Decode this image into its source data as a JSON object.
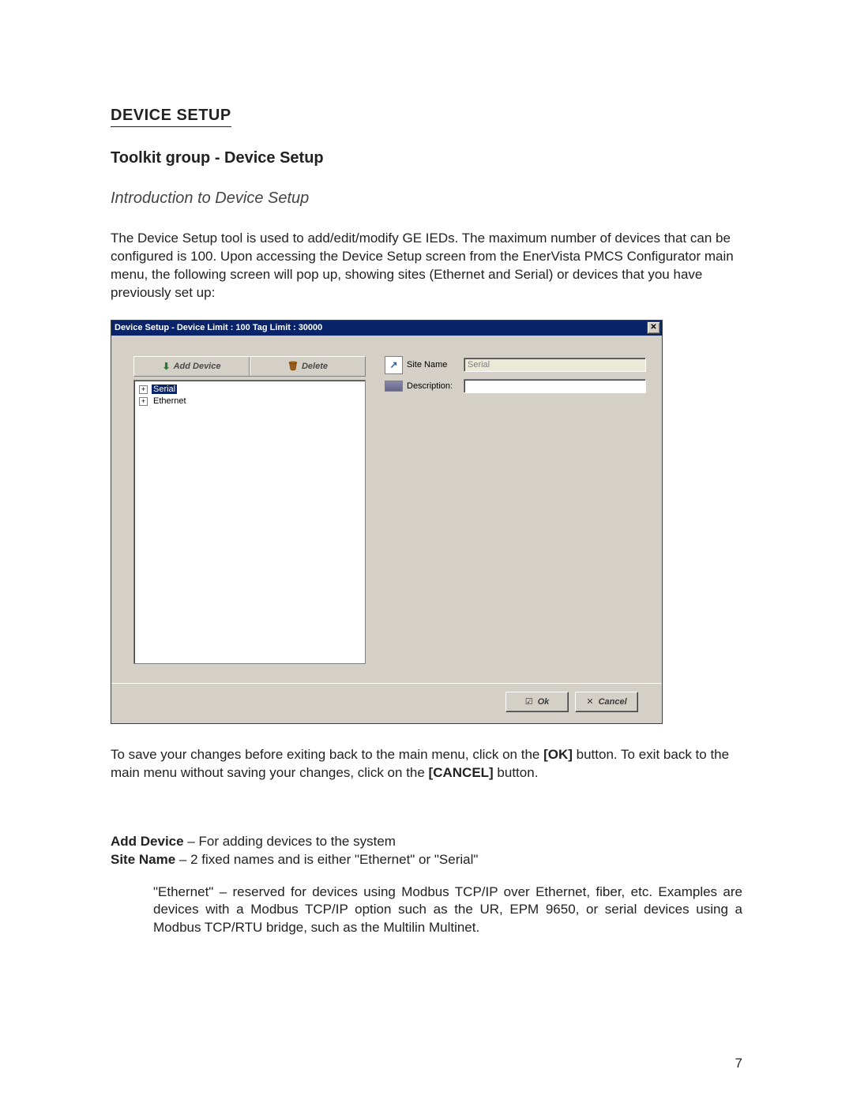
{
  "doc": {
    "section_heading": "DEVICE SETUP",
    "sub_heading": "Toolkit group - Device Setup",
    "intro_heading": "Introduction to Device Setup",
    "intro_paragraph": "The Device Setup tool is used to add/edit/modify GE IEDs.  The maximum number of devices that can be configured is 100.  Upon accessing the Device Setup screen from the EnerVista PMCS Configurator main menu, the following screen will pop up, showing sites (Ethernet and Serial) or devices that you have previously set up:",
    "after1_a": "To save your changes before exiting back to the main menu, click on the ",
    "after1_b": "[OK]",
    "after1_c": " button.  To exit back to the main menu without saving your changes, click on the ",
    "after1_d": "[CANCEL]",
    "after1_e": " button.",
    "def_add_device_term": "Add Device",
    "def_add_device_desc": " – For adding devices to the system",
    "def_site_name_term": "Site Name",
    "def_site_name_desc": " – 2 fixed names and is either \"Ethernet\" or \"Serial\"",
    "ethernet_para": "\"Ethernet\" – reserved for devices using Modbus TCP/IP over Ethernet, fiber, etc.  Examples are devices with a Modbus TCP/IP option such as the UR, EPM 9650, or serial devices using a Modbus TCP/RTU bridge, such as the Multilin Multinet.",
    "page_number": "7"
  },
  "dialog": {
    "title": "Device Setup - Device Limit : 100 Tag Limit : 30000",
    "add_label": "Add Device",
    "delete_label": "Delete",
    "tree": {
      "item_serial": "Serial",
      "item_ethernet": "Ethernet"
    },
    "form": {
      "site_name_label": "Site Name",
      "site_name_value": "Serial",
      "description_label": "Description:",
      "description_value": ""
    },
    "ok_label": "Ok",
    "cancel_label": "Cancel"
  }
}
